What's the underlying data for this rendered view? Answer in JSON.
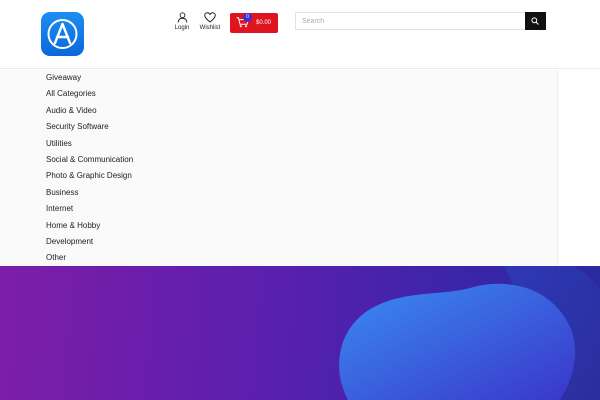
{
  "header": {
    "login_label": "Login",
    "wishlist_label": "Wishlist",
    "cart": {
      "count": "0",
      "total": "$0.00"
    },
    "search": {
      "placeholder": "Search",
      "value": ""
    }
  },
  "categories": [
    "Giveaway",
    "All Categories",
    "Audio & Video",
    "Security Software",
    "Utilities",
    "Social & Communication",
    "Photo & Graphic Design",
    "Business",
    "Internet",
    "Home & Hobby",
    "Development",
    "Other"
  ],
  "colors": {
    "brand_blue": "#1c8ef3",
    "cart_red": "#e0141e",
    "badge": "#3b2fd4",
    "hero_start": "#7d1ea8",
    "hero_end": "#2a2a9e"
  }
}
